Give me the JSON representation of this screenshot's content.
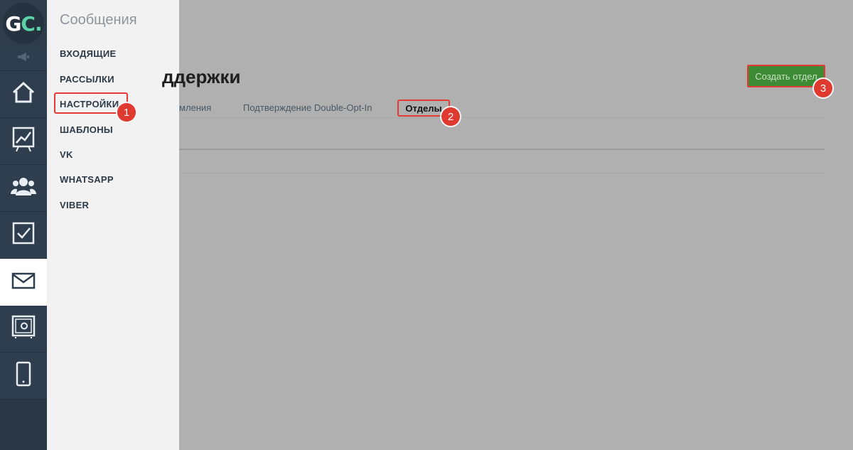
{
  "logo": {
    "text_main": "G",
    "text_accent": "C",
    "dot": "."
  },
  "submenu": {
    "title": "Сообщения",
    "items": [
      {
        "label": "ВХОДЯЩИЕ"
      },
      {
        "label": "РАССЫЛКИ"
      },
      {
        "label": "НАСТРОЙКИ"
      },
      {
        "label": "ШАБЛОНЫ"
      },
      {
        "label": "VK"
      },
      {
        "label": "WHATSAPP"
      },
      {
        "label": "VIBER"
      }
    ]
  },
  "main": {
    "title": "ддержки",
    "tabs": [
      {
        "label": "мления"
      },
      {
        "label": "Подтверждение Double-Opt-In"
      },
      {
        "label": "Отделы"
      }
    ],
    "create_button": "Создать отдел"
  },
  "annotations": [
    "1",
    "2",
    "3"
  ],
  "colors": {
    "rail": "#2e3e4e",
    "accent_green": "#5bd3a6",
    "button_green": "#3e8b35",
    "highlight_red": "#e53935"
  }
}
